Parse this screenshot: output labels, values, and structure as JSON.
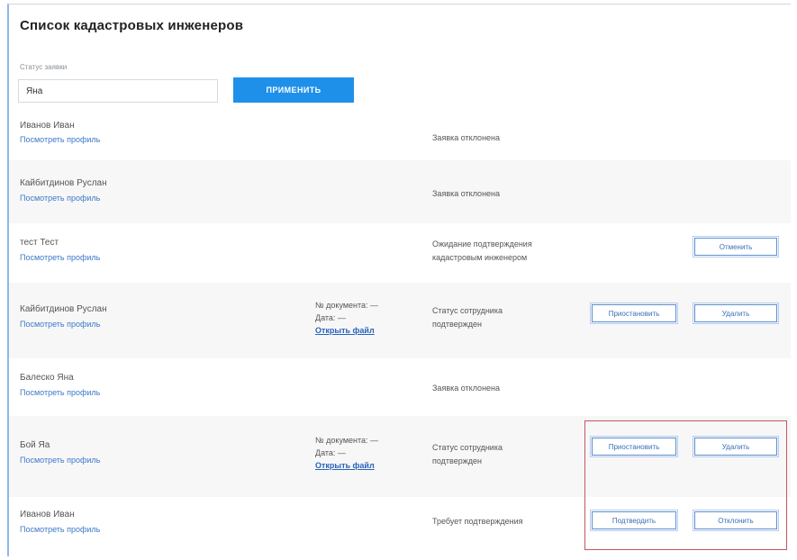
{
  "page_title": "Список кадастровых инженеров",
  "filter": {
    "label": "Статус заявки",
    "value": "Яна",
    "apply_label": "ПРИМЕНИТЬ"
  },
  "rows": [
    {
      "name": "Иванов Иван",
      "profile_link": "Посмотреть профиль",
      "status": "Заявка отклонена"
    },
    {
      "name": "Кайбитдинов Руслан",
      "profile_link": "Посмотреть профиль",
      "status": "Заявка отклонена"
    },
    {
      "name": "тест Тест",
      "profile_link": "Посмотреть профиль",
      "status_line1": "Ожидание подтверждения",
      "status_line2": "кадастровым инженером",
      "cancel_label": "Отменить"
    },
    {
      "name": "Кайбитдинов Руслан",
      "profile_link": "Посмотреть профиль",
      "doc_number": "№ документа: —",
      "doc_date": "Дата: —",
      "download_label": "Открыть файл",
      "status_line1": "Статус сотрудника",
      "status_line2": "подтвержден",
      "suspend_label": "Приостановить",
      "delete_label": "Удалить"
    },
    {
      "name": "Балеско Яна",
      "profile_link": "Посмотреть профиль",
      "status": "Заявка отклонена"
    },
    {
      "name": "Бой Яа",
      "profile_link": "Посмотреть профиль",
      "doc_number": "№ документа: —",
      "doc_date": "Дата: —",
      "download_label": "Открыть файл",
      "status_line1": "Статус сотрудника",
      "status_line2": "подтвержден",
      "suspend_label": "Приостановить",
      "delete_label": "Удалить"
    },
    {
      "name": "Иванов Иван",
      "profile_link": "Посмотреть профиль",
      "status": "Требует подтверждения",
      "confirm_label": "Подтвердить",
      "reject_label": "Отклонить"
    }
  ],
  "colors": {
    "accent": "#1e90ea",
    "link": "#3d78c8",
    "highlight": "#c25560"
  }
}
